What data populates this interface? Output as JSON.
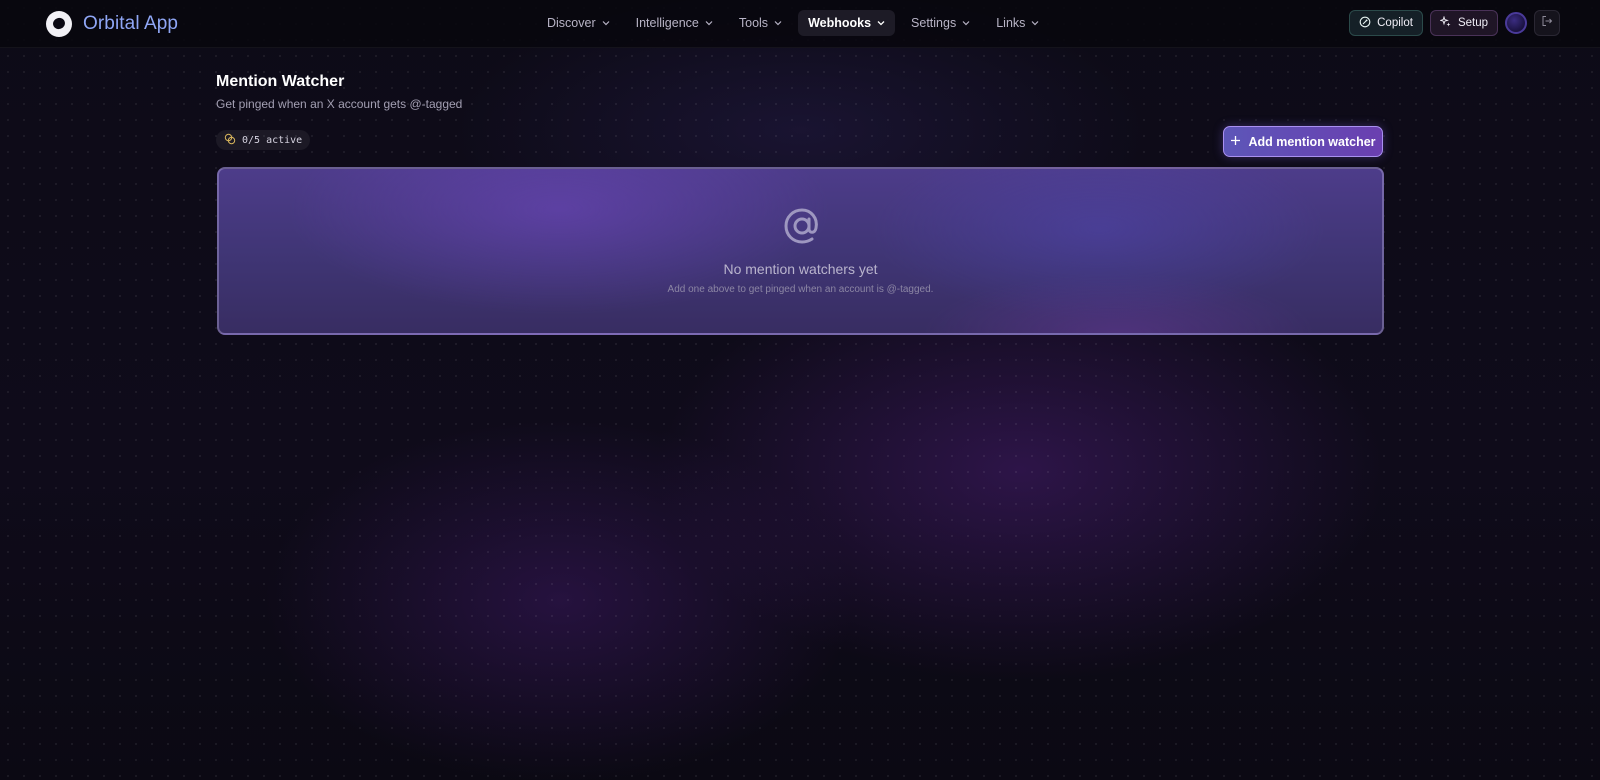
{
  "app": {
    "name": "Orbital App"
  },
  "nav": {
    "items": [
      {
        "label": "Discover",
        "active": false
      },
      {
        "label": "Intelligence",
        "active": false
      },
      {
        "label": "Tools",
        "active": false
      },
      {
        "label": "Webhooks",
        "active": true
      },
      {
        "label": "Settings",
        "active": false
      },
      {
        "label": "Links",
        "active": false
      }
    ]
  },
  "header_actions": {
    "copilot_label": "Copilot",
    "copilot_icon": "copilot-icon",
    "setup_label": "Setup",
    "setup_icon": "sparkles-icon",
    "logout_icon": "logout-icon"
  },
  "page": {
    "title": "Mention Watcher",
    "subtitle": "Get pinged when an X account gets @-tagged",
    "active_count": "0/5 active",
    "active_icon": "coins-icon",
    "add_button_label": "Add mention watcher",
    "add_button_icon": "plus-icon"
  },
  "empty_state": {
    "icon": "at-sign-icon",
    "title": "No mention watchers yet",
    "description": "Add one above to get pinged when an account is @-tagged."
  },
  "colors": {
    "background": "#0b0913",
    "brand": "#8fa6f5",
    "accent": "#6a3fb0",
    "copilot_border": "#2b4a4a",
    "setup_border": "#4a3258"
  }
}
